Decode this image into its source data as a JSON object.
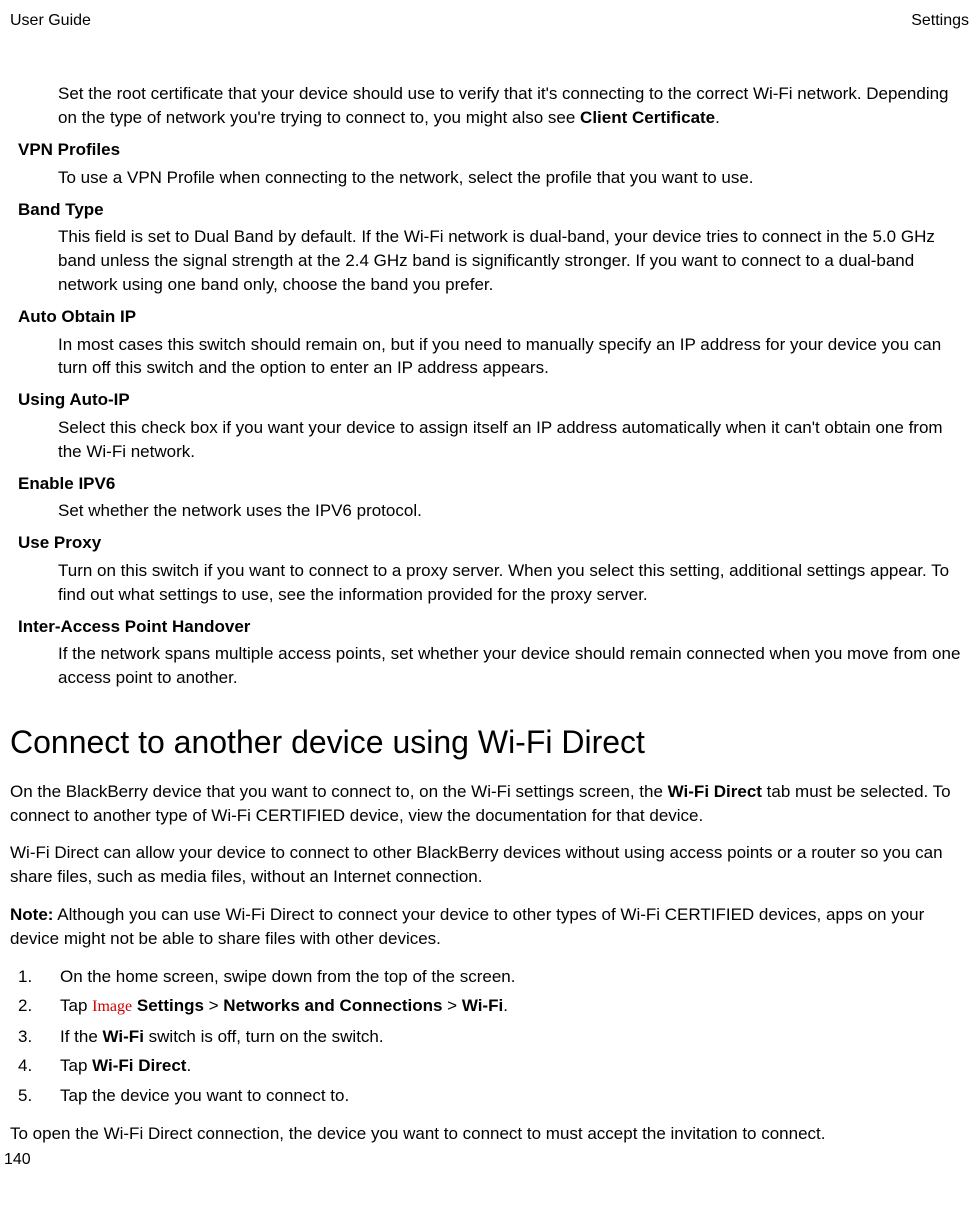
{
  "header": {
    "left": "User Guide",
    "right": "Settings"
  },
  "intro_indent": "Set the root certificate that your device should use to verify that it's connecting to the correct Wi-Fi network. Depending on the type of network you're trying to connect to, you might also see ",
  "intro_bold": "Client Certificate",
  "intro_tail": ".",
  "terms": [
    {
      "label": "VPN Profiles",
      "body": "To use a VPN Profile when connecting to the network, select the profile that you want to use."
    },
    {
      "label": "Band Type",
      "body": "This field is set to Dual Band by default. If the Wi-Fi network is dual-band, your device tries to connect in the 5.0 GHz band unless the signal strength at the 2.4 GHz band is significantly stronger. If you want to connect to a dual-band network using one band only, choose the band you prefer."
    },
    {
      "label": "Auto Obtain IP",
      "body": "In most cases this switch should remain on, but if you need to manually specify an IP address for your device you can turn off this switch and the option to enter an IP address appears."
    },
    {
      "label": "Using Auto-IP",
      "body": "Select this check box if you want your device to assign itself an IP address automatically when it can't obtain one from the Wi-Fi network."
    },
    {
      "label": "Enable IPV6",
      "body": "Set whether the network uses the IPV6 protocol."
    },
    {
      "label": "Use Proxy",
      "body": "Turn on this switch if you want to connect to a proxy server. When you select this setting, additional settings appear. To find out what settings to use, see the information provided for the proxy server."
    },
    {
      "label": "Inter-Access Point Handover",
      "body": "If the network spans multiple access points, set whether your device should remain connected when you move from one access point to another."
    }
  ],
  "h2": "Connect to another device using Wi-Fi Direct",
  "p1_a": "On the BlackBerry device that you want to connect to, on the Wi-Fi settings screen, the ",
  "p1_bold": "Wi-Fi Direct",
  "p1_b": " tab must be selected. To connect to another type of Wi-Fi CERTIFIED device, view the documentation for that device.",
  "p2": "Wi-Fi Direct can allow your device to connect to other BlackBerry devices without using access points or a router so you can share files, such as media files, without an Internet connection.",
  "p3_label": "Note:",
  "p3_body": " Although you can use Wi-Fi Direct to connect your device to other types of Wi-Fi CERTIFIED devices, apps on your device might not be able to share files with other devices.",
  "steps": {
    "s1": "On the home screen, swipe down from the top of the screen.",
    "s2_a": "Tap ",
    "s2_img": "Image",
    "s2_b": " ",
    "s2_settings": "Settings",
    "s2_gt1": " > ",
    "s2_nc": "Networks and Connections",
    "s2_gt2": " > ",
    "s2_wifi": "Wi-Fi",
    "s2_dot": ".",
    "s3_a": "If the ",
    "s3_bold": "Wi-Fi",
    "s3_b": " switch is off, turn on the switch.",
    "s4_a": "Tap ",
    "s4_bold": "Wi-Fi Direct",
    "s4_dot": ".",
    "s5": "Tap the device you want to connect to."
  },
  "closing": "To open the Wi-Fi Direct connection, the device you want to connect to must accept the invitation to connect.",
  "page_num": "140"
}
